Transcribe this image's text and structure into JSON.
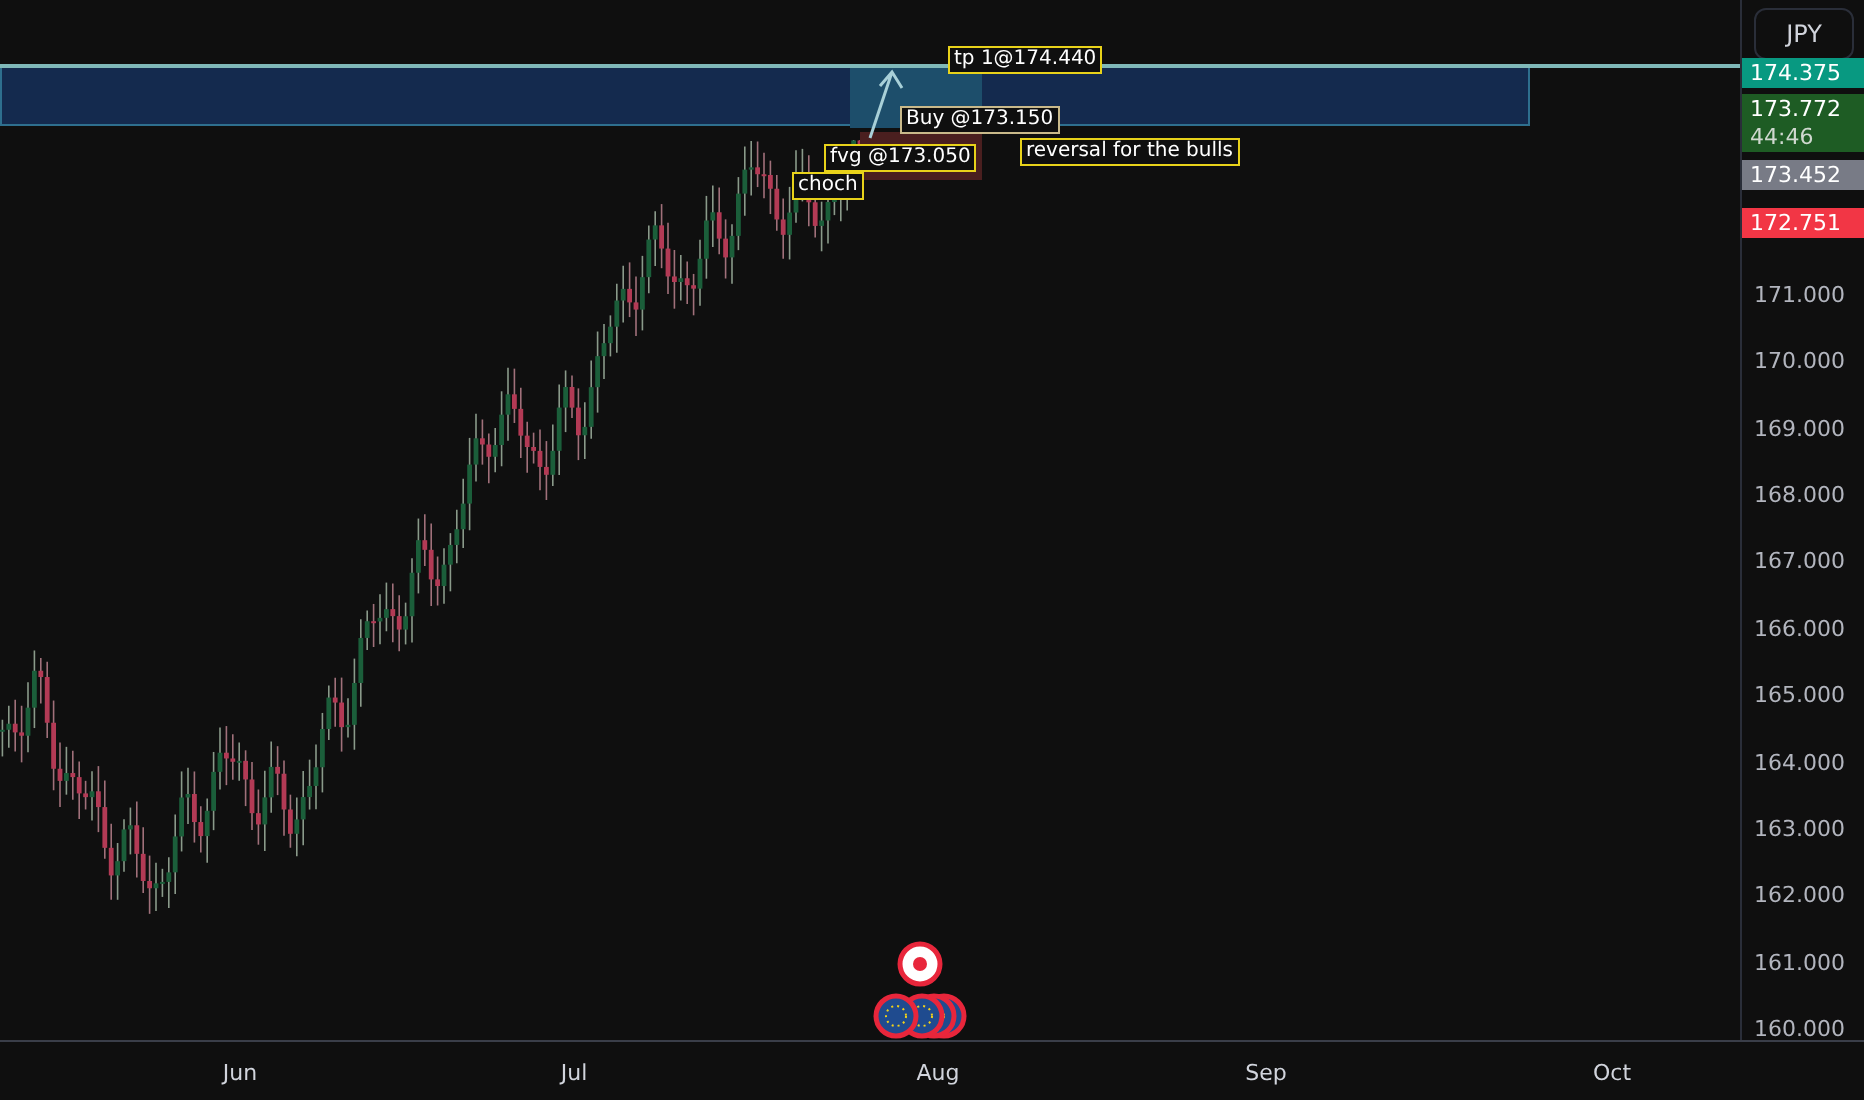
{
  "currency_button": "JPY",
  "price_ticks": [
    "171.000",
    "170.000",
    "169.000",
    "168.000",
    "167.000",
    "166.000",
    "165.000",
    "164.000",
    "163.000",
    "162.000",
    "161.000",
    "160.000"
  ],
  "price_labels": [
    {
      "price": "174.375",
      "color": "#089981"
    },
    {
      "price": "173.772",
      "timer": "44:46",
      "color": "#1e5c24"
    },
    {
      "price": "173.452",
      "color": "#787b86"
    },
    {
      "price": "172.751",
      "color": "#f23645"
    }
  ],
  "time_labels": [
    "Jun",
    "Jul",
    "Aug",
    "Sep",
    "Oct"
  ],
  "annotations": [
    {
      "kind": "tp",
      "text": "tp 1@174.440"
    },
    {
      "kind": "entry",
      "text": "Buy @173.150"
    },
    {
      "kind": "fvg",
      "text": "fvg @173.050"
    },
    {
      "kind": "choch",
      "text": "choch"
    },
    {
      "kind": "note",
      "text": "reversal for the bulls"
    }
  ]
}
